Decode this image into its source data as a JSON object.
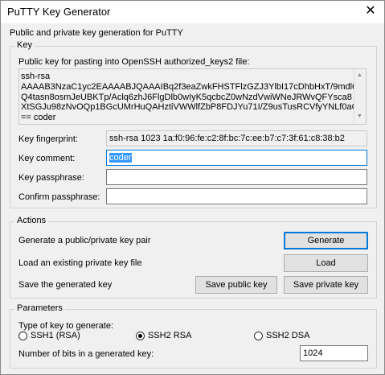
{
  "window": {
    "title": "PuTTY Key Generator",
    "close_glyph": "✕"
  },
  "intro": "Public and private key generation for PuTTY",
  "key_group": {
    "label": "Key",
    "pubkey_label": "Public key for pasting into OpenSSH authorized_keys2 file:",
    "pubkey_lines": [
      "ssh-rsa",
      "AAAAB3NzaC1yc2EAAAABJQAAAIBq2f3eaZwkFHSTFlzGZJ3YlbI17cDhbHxT/9mdl6",
      "Q4tasn8osmJeUBKTp/Aclq6zhJ6FlgDlb0wIyK5qcbcZ0wNzdVwiWNeJRWvQFYsca8",
      "XtSGJu98zNvOQp1BGcUMrHuQAHztiVWWlfZbP8FDJYu71I/Z9usTusRCVfyYNLf0aQ",
      "== coder"
    ],
    "fingerprint_label": "Key fingerprint:",
    "fingerprint_value": "ssh-rsa 1023 1a:f0:96:fe:c2:8f:bc:7c:ee:b7:c7:3f:61:c8:38:b2",
    "comment_label": "Key comment:",
    "comment_value": "coder",
    "passphrase_label": "Key passphrase:",
    "passphrase_value": "",
    "confirm_label": "Confirm passphrase:",
    "confirm_value": ""
  },
  "actions_group": {
    "label": "Actions",
    "generate_text": "Generate a public/private key pair",
    "generate_button": "Generate",
    "load_text": "Load an existing private key file",
    "load_button": "Load",
    "save_text": "Save the generated key",
    "save_public_button": "Save public key",
    "save_private_button": "Save private key"
  },
  "params_group": {
    "label": "Parameters",
    "type_label": "Type of key to generate:",
    "types": [
      "SSH1 (RSA)",
      "SSH2 RSA",
      "SSH2 DSA"
    ],
    "selected_type": "SSH2 RSA",
    "bits_label": "Number of bits in a generated key:",
    "bits_value": "1024"
  },
  "colors": {
    "accent": "#0078d7",
    "selection": "#3399ff",
    "dialog_bg": "#f0f0f0"
  }
}
